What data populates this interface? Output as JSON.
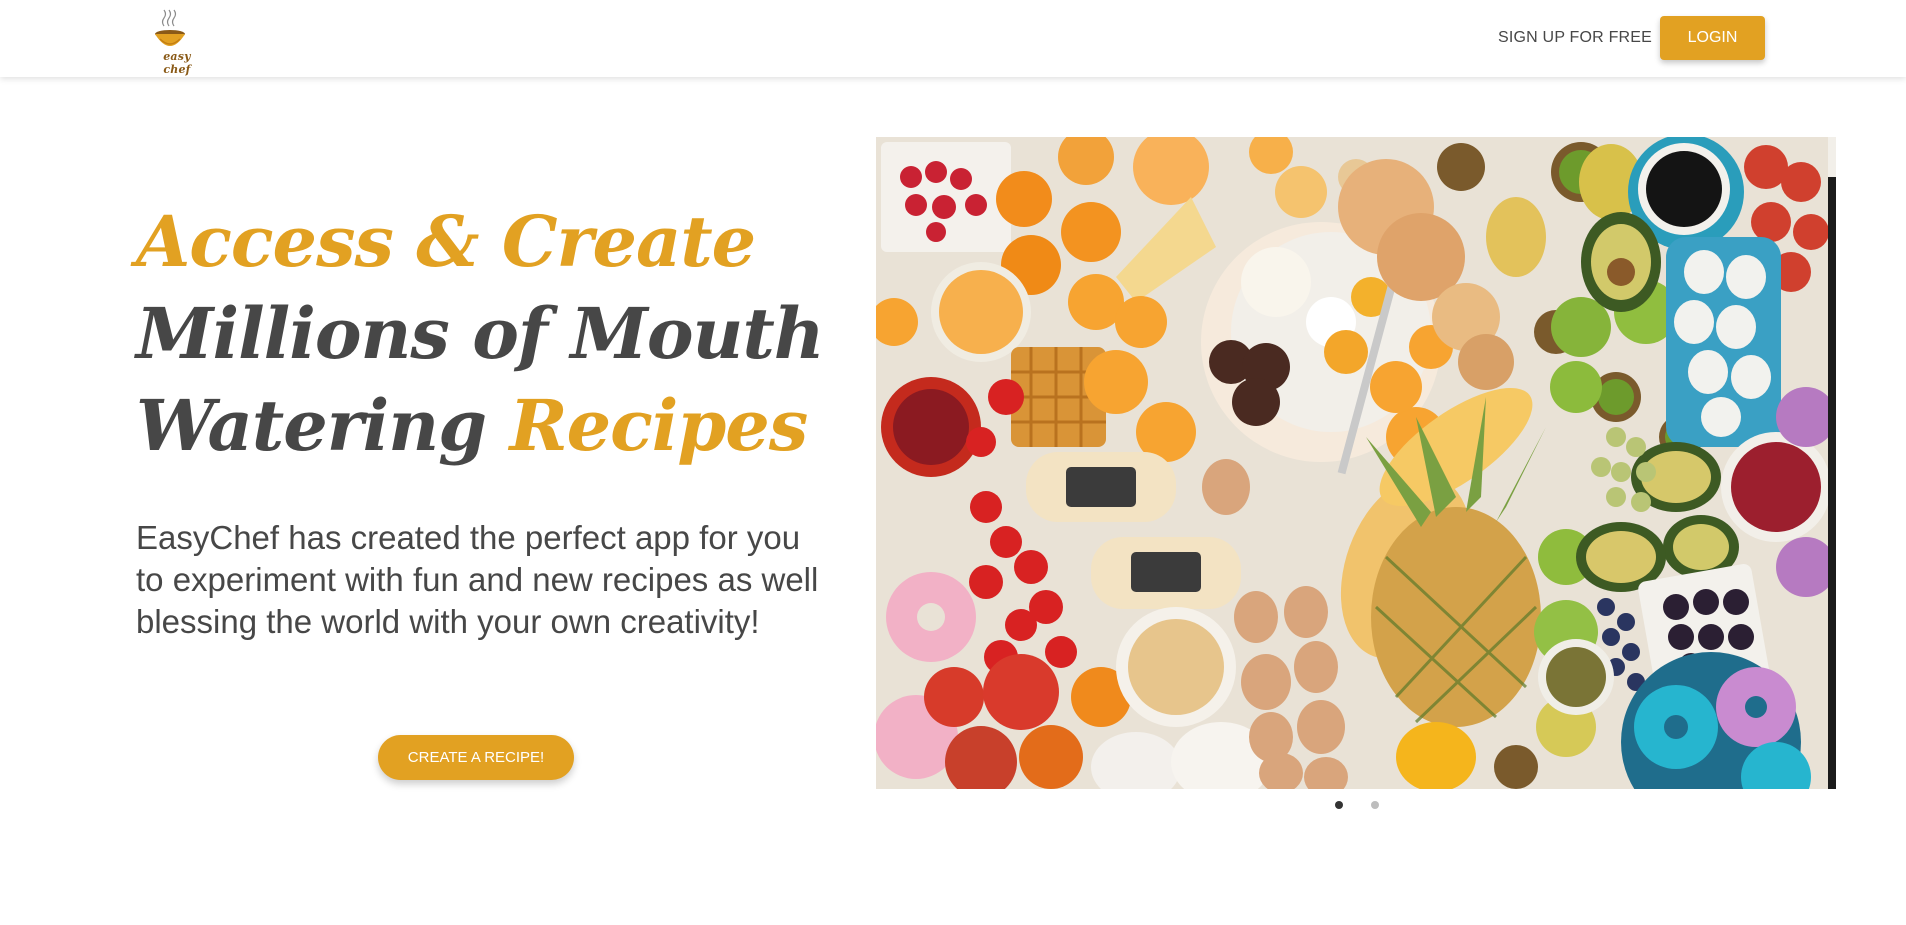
{
  "header": {
    "logo_text": "easy chef",
    "signup_label": "SIGN UP FOR FREE",
    "login_label": "LOGIN"
  },
  "hero": {
    "headline": {
      "part1": "Access & Create",
      "part2": "Millions of Mouth",
      "part3": "Watering ",
      "part4": "Recipes"
    },
    "description": "EasyChef has created the perfect app for you to experiment with fun and new recipes as well blessing the world with your own creativity!",
    "create_button_label": "CREATE A RECIPE!"
  },
  "carousel": {
    "slide_count": 2,
    "active_index": 0
  },
  "colors": {
    "accent": "#e2a122",
    "text": "#474747"
  }
}
